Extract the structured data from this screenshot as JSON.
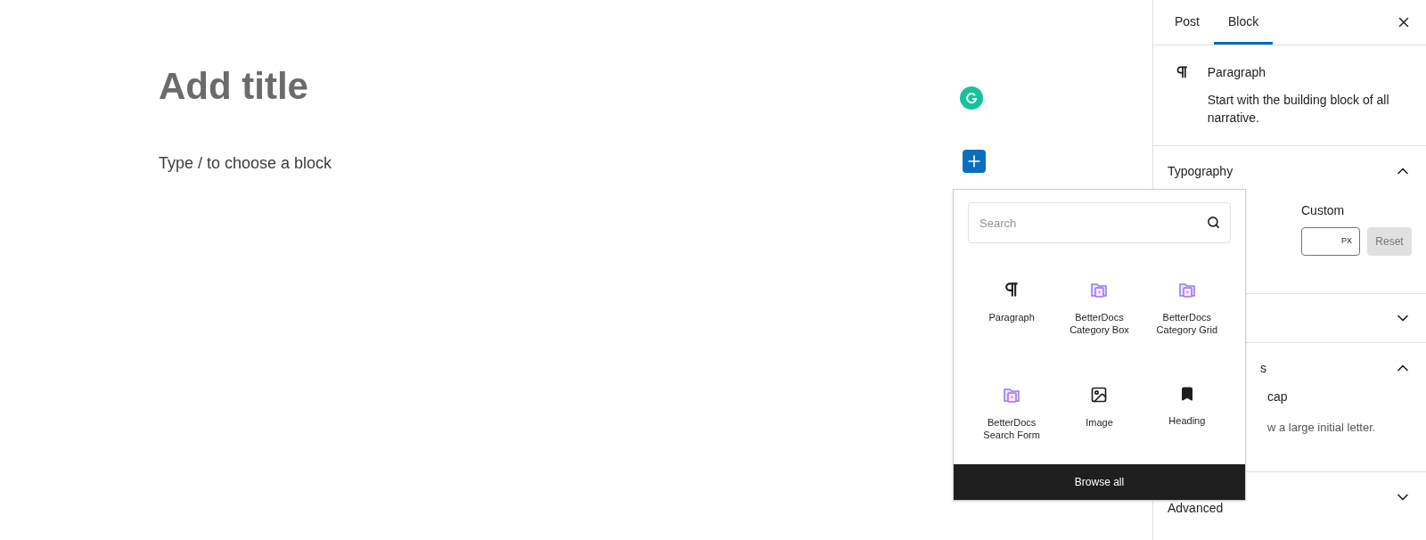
{
  "editor": {
    "title_placeholder": "Add title",
    "block_placeholder": "Type / to choose a block"
  },
  "inserter": {
    "search": {
      "placeholder": "Search"
    },
    "blocks": [
      {
        "label": "Paragraph",
        "kind": "paragraph"
      },
      {
        "label": "BetterDocs Category Box",
        "kind": "betterdocs"
      },
      {
        "label": "BetterDocs Category Grid",
        "kind": "betterdocs"
      },
      {
        "label": "BetterDocs Search Form",
        "kind": "betterdocs"
      },
      {
        "label": "Image",
        "kind": "image"
      },
      {
        "label": "Heading",
        "kind": "heading"
      }
    ],
    "browse_all": "Browse all"
  },
  "sidebar": {
    "tabs": [
      {
        "label": "Post",
        "selected": false
      },
      {
        "label": "Block",
        "selected": true
      }
    ],
    "block_card": {
      "name": "Paragraph",
      "description": "Start with the building block of all narrative."
    },
    "panels": [
      {
        "title": "Typography",
        "expanded": true,
        "custom_label": "Custom",
        "unit": "PX",
        "reset": "Reset"
      },
      {
        "expanded": false
      },
      {
        "title": "s",
        "expanded": true,
        "toggle_label": "cap",
        "help": "w a large initial letter."
      },
      {
        "title": "Advanced",
        "expanded": false
      }
    ]
  }
}
